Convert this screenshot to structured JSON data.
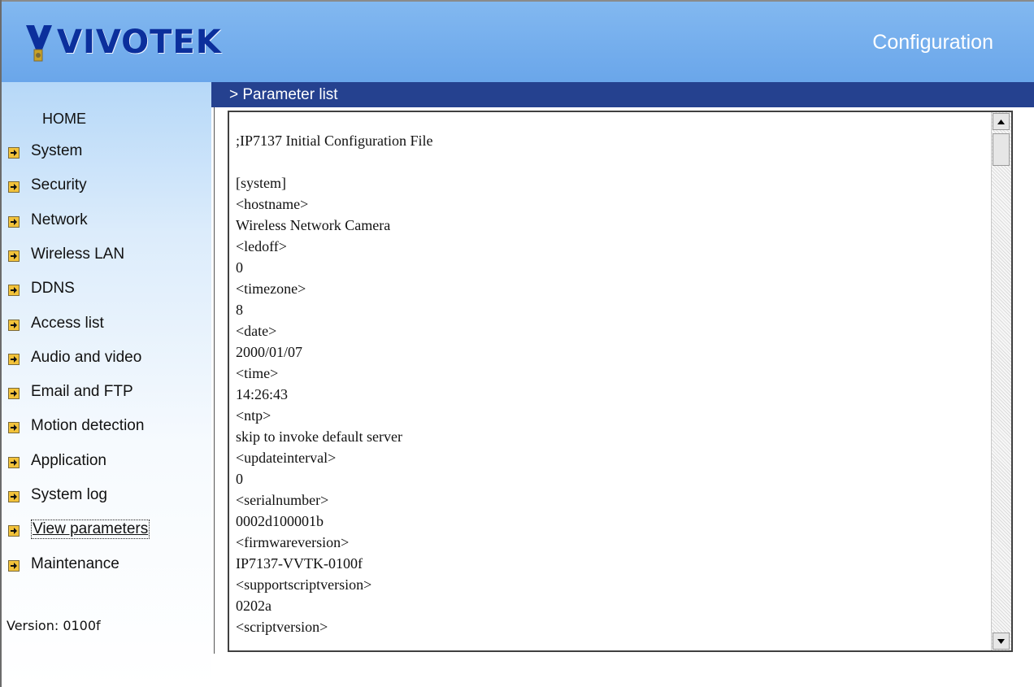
{
  "header": {
    "logo_text": "VIVOTEK",
    "title": "Configuration",
    "colors": {
      "header_bg": "#6aa6ea",
      "title_bar": "#25418f",
      "logo": "#0b2f9c"
    }
  },
  "sidebar": {
    "home_label": "HOME",
    "items": [
      {
        "label": "System"
      },
      {
        "label": "Security"
      },
      {
        "label": "Network"
      },
      {
        "label": "Wireless LAN"
      },
      {
        "label": "DDNS"
      },
      {
        "label": "Access list"
      },
      {
        "label": "Audio and video"
      },
      {
        "label": "Email and FTP"
      },
      {
        "label": "Motion detection"
      },
      {
        "label": "Application"
      },
      {
        "label": "System log"
      },
      {
        "label": "View parameters",
        "active": true
      },
      {
        "label": "Maintenance"
      }
    ],
    "version": "Version: 0100f"
  },
  "main": {
    "section_title": "> Parameter list",
    "parameter_lines": [
      ";IP7137 Initial Configuration File",
      "[system]",
      "<hostname>",
      "Wireless Network Camera",
      "<ledoff>",
      "0",
      "<timezone>",
      "8",
      "<date>",
      "2000/01/07",
      "<time>",
      "14:26:43",
      "<ntp>",
      "skip to invoke default server",
      "<updateinterval>",
      "0",
      "<serialnumber>",
      "0002d100001b",
      "<firmwareversion>",
      "IP7137-VVTK-0100f",
      "<supportscriptversion>",
      "0202a",
      "<scriptversion>"
    ]
  }
}
